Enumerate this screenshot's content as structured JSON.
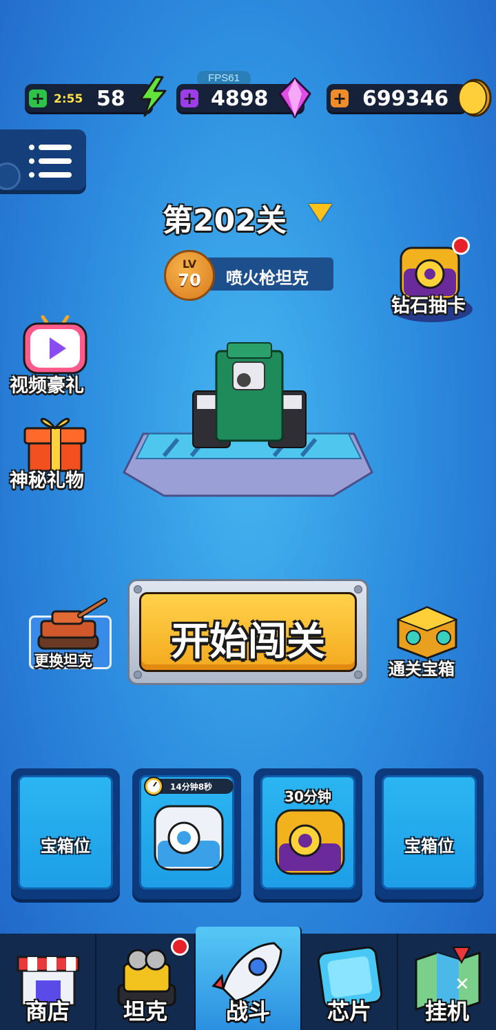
{
  "status_bar": {
    "fps": "FPS61",
    "energy": {
      "timer": "2:55",
      "value": "58"
    },
    "gems": {
      "value": "4898"
    },
    "coins": {
      "value": "699346"
    }
  },
  "level": {
    "title": "第202关"
  },
  "tank": {
    "lv_label": "LV",
    "lv_value": "70",
    "name": "喷火枪坦克"
  },
  "side_left": {
    "video_gift": "视频豪礼",
    "mystery_gift": "神秘礼物",
    "change_tank": "更换坦克"
  },
  "side_right": {
    "diamond_draw": "钻石抽卡",
    "clear_chest": "通关宝箱"
  },
  "start_button": "开始闯关",
  "chest_slots": [
    {
      "label": "宝箱位"
    },
    {
      "timer": "14分钟8秒"
    },
    {
      "timer": "30分钟"
    },
    {
      "label": "宝箱位"
    }
  ],
  "nav": {
    "shop": "商店",
    "tank": "坦克",
    "battle": "战斗",
    "chip": "芯片",
    "idle": "挂机"
  },
  "colors": {
    "accent_gold": "#ffc21a",
    "bg_blue": "#2e8fe0",
    "energy_green": "#2ec24a",
    "gem_purple": "#9b3ee8",
    "coin_orange": "#f08c2a"
  }
}
